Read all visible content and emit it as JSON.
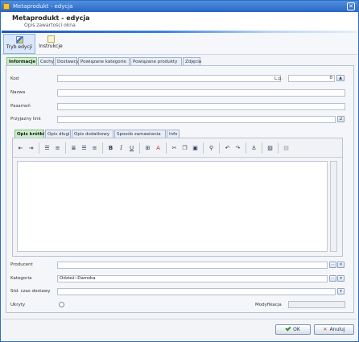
{
  "window": {
    "title": "Metaprodukt - edycja",
    "close_glyph": "✕"
  },
  "header": {
    "title": "Metaprodukt - edycja",
    "subtitle": "Opis zawartości okna"
  },
  "ribbon": {
    "buttons": [
      {
        "label": "Tryb edycji",
        "icon": "edit-mode-icon",
        "active": true
      },
      {
        "label": "Instrukcje",
        "icon": "instructions-icon",
        "active": false
      }
    ]
  },
  "main_tabs": [
    "Informacje",
    "Cechy",
    "Dostawcy",
    "Powiązane kategorie",
    "Powiązane produkty",
    "Zdjęcia"
  ],
  "form": {
    "kod": {
      "label": "Kod",
      "value": ""
    },
    "lp": {
      "label": "L.p.",
      "value": "0"
    },
    "nazwa": {
      "label": "Nazwa",
      "value": ""
    },
    "pasamon": {
      "label": "Pasamoń",
      "value": ""
    },
    "przyjazny_link": {
      "label": "Przyjazny link",
      "value": ""
    },
    "producent": {
      "label": "Producent",
      "value": ""
    },
    "kategoria": {
      "label": "Kategoria",
      "value": "Odzież::Damska"
    },
    "czas_dostawy": {
      "label": "Std. czas dostawy",
      "value": ""
    },
    "ukryty": {
      "label": "Ukryty"
    },
    "modyfikacja": {
      "label": "Modyfikacja",
      "value": ""
    }
  },
  "desc_tabs": [
    "Opis krótki",
    "Opis długi",
    "Opis dodatkowy",
    "Sposób zamawiania",
    "Info"
  ],
  "editor": {
    "content": "",
    "tools": {
      "bold": "B",
      "italic": "I",
      "underline": "U",
      "font_color": "A"
    }
  },
  "footer": {
    "ok_label": "OK",
    "cancel_label": "Anuluj"
  },
  "colors": {
    "accent": "#2a66c2",
    "active_tab": "#cdeecd"
  }
}
